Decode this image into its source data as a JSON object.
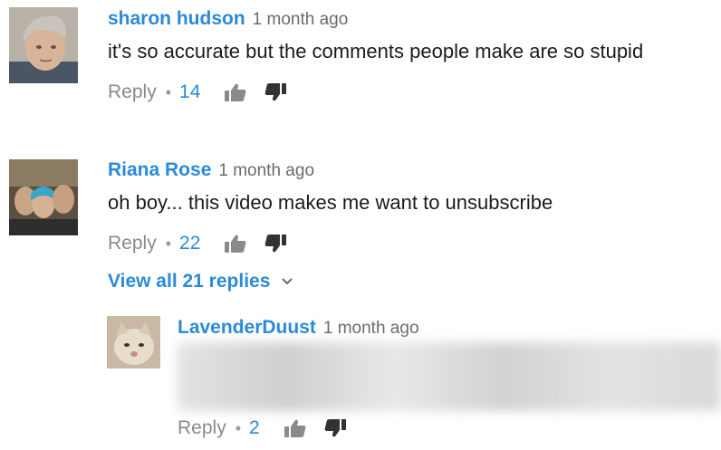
{
  "comments": [
    {
      "author": "sharon hudson",
      "time": "1 month ago",
      "text": "it's so accurate but the comments people make are so stupid",
      "reply_label": "Reply",
      "separator": "•",
      "likes": "14"
    },
    {
      "author": "Riana Rose",
      "time": "1 month ago",
      "text": "oh boy... this video makes me want to unsubscribe",
      "reply_label": "Reply",
      "separator": "•",
      "likes": "22",
      "view_replies": "View all 21 replies"
    }
  ],
  "reply": {
    "author": "LavenderDuust",
    "time": "1 month ago",
    "text_obscured": true,
    "reply_label": "Reply",
    "separator": "•",
    "likes": "2"
  },
  "colors": {
    "author": "#2a8ad9",
    "meta": "#6b6b6b",
    "icon": "#8a8a8a"
  }
}
